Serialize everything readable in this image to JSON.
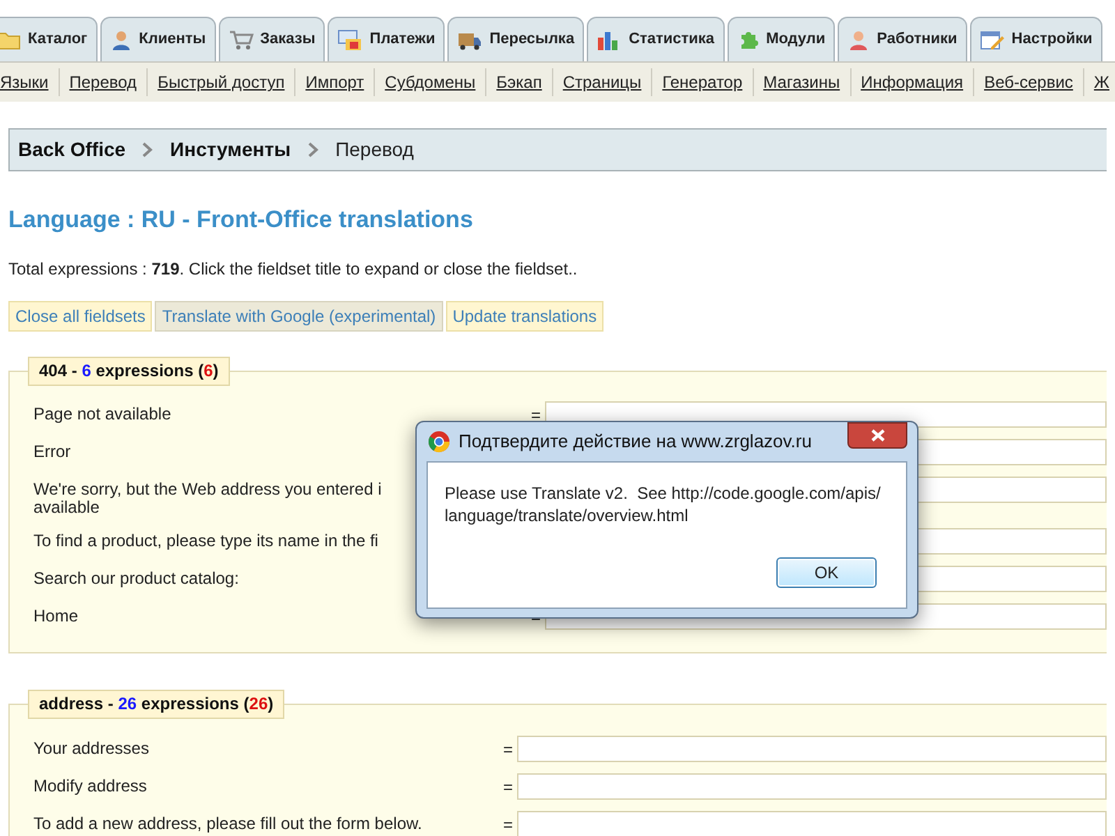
{
  "tabs": [
    {
      "label": "Каталог"
    },
    {
      "label": "Клиенты"
    },
    {
      "label": "Заказы"
    },
    {
      "label": "Платежи"
    },
    {
      "label": "Пересылка"
    },
    {
      "label": "Статистика"
    },
    {
      "label": "Модули"
    },
    {
      "label": "Работники"
    },
    {
      "label": "Настройки"
    }
  ],
  "subnav": [
    "Языки",
    "Перевод",
    "Быстрый доступ",
    "Импорт",
    "Субдомены",
    "Бэкап",
    "Страницы",
    "Генератор",
    "Магазины",
    "Информация",
    "Веб-сервис",
    "Ж"
  ],
  "breadcrumb": [
    {
      "label": "Back Office",
      "kind": "link"
    },
    {
      "label": "Инстументы",
      "kind": "link"
    },
    {
      "label": "Перевод",
      "kind": "current"
    }
  ],
  "title": "Language : RU - Front-Office translations",
  "summary": "Total expressions : **719**. Click the fieldset title to expand or close the fieldset..",
  "actions": [
    {
      "label": "Close all fieldsets",
      "active": false
    },
    {
      "label": "Translate with Google (experimental)",
      "active": true
    },
    {
      "label": "Update translations",
      "active": false
    }
  ],
  "fieldsets": [
    {
      "legend": [
        {
          "text": "404 - ",
          "color": "#111111"
        },
        {
          "text": "6",
          "color": "#1a1aff"
        },
        {
          "text": " expressions (",
          "color": "#111111"
        },
        {
          "text": "6",
          "color": "#dd1111"
        },
        {
          "text": ")",
          "color": "#111111"
        }
      ],
      "equals": "=",
      "rows": [
        "Page not available",
        "Error",
        "We're sorry, but the Web address you entered i\navailable",
        "To find a product, please type its name in the fi",
        "Search our product catalog:",
        "Home"
      ]
    },
    {
      "legend": [
        {
          "text": "address - ",
          "color": "#111111"
        },
        {
          "text": "26",
          "color": "#1a1aff"
        },
        {
          "text": " expressions (",
          "color": "#111111"
        },
        {
          "text": "26",
          "color": "#dd1111"
        },
        {
          "text": ")",
          "color": "#111111"
        }
      ],
      "equals": "=",
      "rows": [
        "Your addresses",
        "Modify address",
        "To add a new address, please fill out the form below."
      ]
    }
  ],
  "dialog": {
    "title": "Подтвердите действие на www.zrglazov.ru",
    "message": "Please use Translate v2.  See http://code.google.com/apis/\nlanguage/translate/overview.html",
    "button": "OK"
  }
}
